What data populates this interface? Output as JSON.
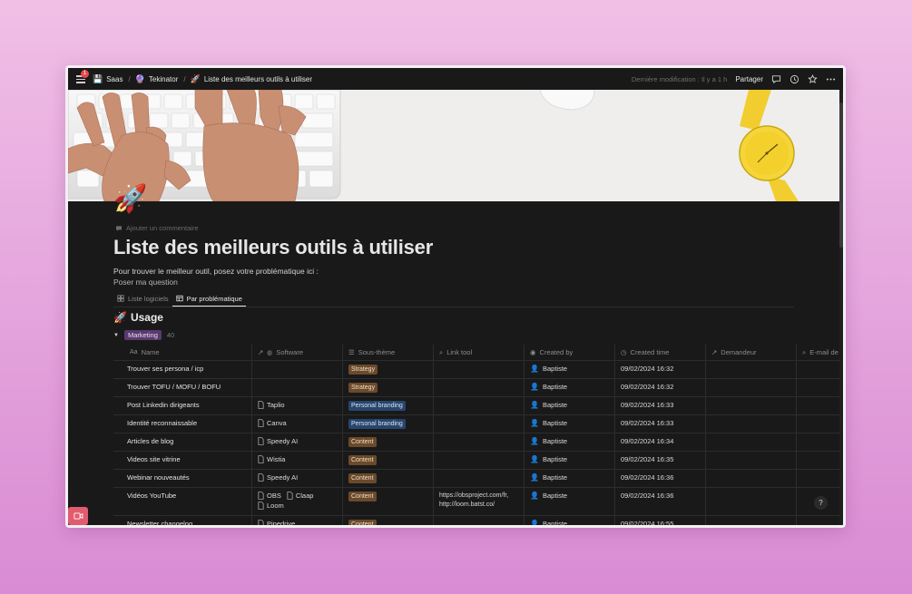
{
  "topbar": {
    "notification_count": "1",
    "breadcrumbs": [
      {
        "icon": "💾",
        "label": "Saas"
      },
      {
        "icon": "🔮",
        "label": "Tekinator"
      },
      {
        "icon": "🚀",
        "label": "Liste des meilleurs outils à utiliser"
      }
    ],
    "last_modified": "Dernière modification : Il y a 1 h",
    "share_label": "Partager"
  },
  "page": {
    "icon": "🚀",
    "add_comment": "Ajouter un commentaire",
    "title": "Liste des meilleurs outils à utiliser",
    "description": "Pour trouver le meilleur outil, posez votre problématique ici :",
    "question_link": "Poser ma question"
  },
  "tabs": [
    {
      "label": "Liste logiciels",
      "active": false
    },
    {
      "label": "Par problématique",
      "active": true
    }
  ],
  "section": {
    "icon": "🚀",
    "title": "Usage"
  },
  "group": {
    "label": "Marketing",
    "count": "40"
  },
  "columns": {
    "name": "Name",
    "software": "Software",
    "sous_theme": "Sous-thème",
    "link_tool": "Link tool",
    "created_by": "Created by",
    "created_time": "Created time",
    "demandeur": "Demandeur",
    "email": "E-mail de"
  },
  "rows": [
    {
      "name": "Trouver ses persona / icp",
      "software": [],
      "tag": "Strategy",
      "tag_color": "brown",
      "link": [],
      "by": "Baptiste",
      "time": "09/02/2024 16:32"
    },
    {
      "name": "Trouver TOFU / MOFU / BOFU",
      "software": [],
      "tag": "Strategy",
      "tag_color": "brown",
      "link": [],
      "by": "Baptiste",
      "time": "09/02/2024 16:32"
    },
    {
      "name": "Post Linkedin dirigeants",
      "software": [
        "Taplio"
      ],
      "tag": "Personal branding",
      "tag_color": "blue",
      "link": [],
      "by": "Baptiste",
      "time": "09/02/2024 16:33"
    },
    {
      "name": "Identité reconnaissable",
      "software": [
        "Canva"
      ],
      "tag": "Personal branding",
      "tag_color": "blue",
      "link": [],
      "by": "Baptiste",
      "time": "09/02/2024 16:33"
    },
    {
      "name": "Articles de blog",
      "software": [
        "Speedy AI"
      ],
      "tag": "Content",
      "tag_color": "brown",
      "link": [],
      "by": "Baptiste",
      "time": "09/02/2024 16:34"
    },
    {
      "name": "Videos site vitrine",
      "software": [
        "Wistia"
      ],
      "tag": "Content",
      "tag_color": "brown",
      "link": [],
      "by": "Baptiste",
      "time": "09/02/2024 16:35"
    },
    {
      "name": "Webinar nouveautés",
      "software": [
        "Speedy AI"
      ],
      "tag": "Content",
      "tag_color": "brown",
      "link": [],
      "by": "Baptiste",
      "time": "09/02/2024 16:36"
    },
    {
      "name": "Vidéos YouTube",
      "software": [
        "OBS",
        "Claap",
        "Loom"
      ],
      "tag": "Content",
      "tag_color": "brown",
      "link": [
        "https://obsproject.com/fr,",
        "http://loom.batst.co/"
      ],
      "by": "Baptiste",
      "time": "09/02/2024 16:36"
    },
    {
      "name": "Newsletter changelog",
      "software": [
        "Pipedrive"
      ],
      "tag": "Content",
      "tag_color": "brown",
      "link": [],
      "by": "Baptiste",
      "time": "09/02/2024 16:55"
    }
  ],
  "help_label": "?"
}
